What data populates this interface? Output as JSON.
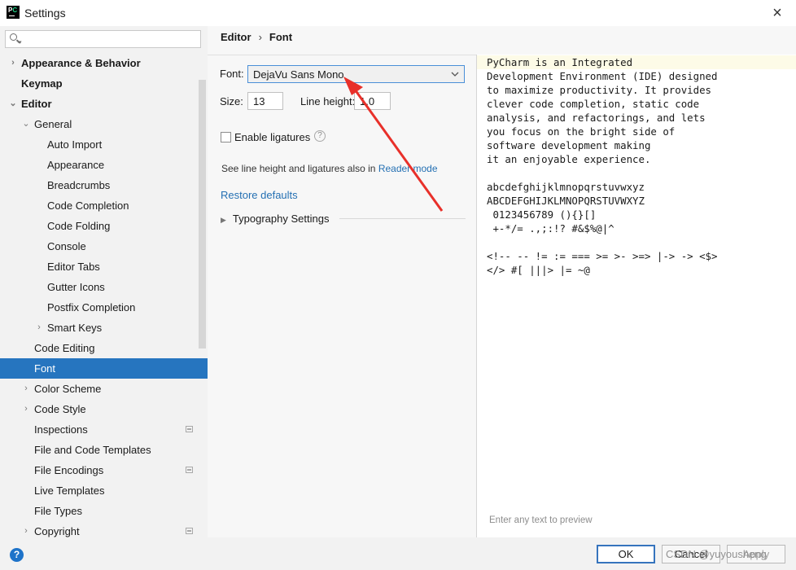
{
  "window": {
    "title": "Settings",
    "icon": "pycharm-icon",
    "close": "×"
  },
  "search": {
    "placeholder": ""
  },
  "sidebar": {
    "items": [
      {
        "label": "Appearance & Behavior",
        "bold": true,
        "chevron": "›"
      },
      {
        "label": "Keymap",
        "bold": true
      },
      {
        "label": "Editor",
        "bold": true,
        "chevron": "⌄"
      },
      {
        "label": "General",
        "chevron": "⌄"
      },
      {
        "label": "Auto Import"
      },
      {
        "label": "Appearance"
      },
      {
        "label": "Breadcrumbs"
      },
      {
        "label": "Code Completion"
      },
      {
        "label": "Code Folding"
      },
      {
        "label": "Console"
      },
      {
        "label": "Editor Tabs"
      },
      {
        "label": "Gutter Icons"
      },
      {
        "label": "Postfix Completion"
      },
      {
        "label": "Smart Keys",
        "chevron": "›"
      },
      {
        "label": "Code Editing"
      },
      {
        "label": "Font",
        "selected": true
      },
      {
        "label": "Color Scheme",
        "chevron": "›"
      },
      {
        "label": "Code Style",
        "chevron": "›"
      },
      {
        "label": "Inspections",
        "project_icon": true
      },
      {
        "label": "File and Code Templates"
      },
      {
        "label": "File Encodings",
        "project_icon": true
      },
      {
        "label": "Live Templates"
      },
      {
        "label": "File Types"
      },
      {
        "label": "Copyright",
        "chevron": "›",
        "project_icon": true
      }
    ]
  },
  "breadcrumb": {
    "parent": "Editor",
    "separator": "›",
    "current": "Font"
  },
  "font_settings": {
    "font_label": "Font:",
    "font_value": "DejaVu Sans Mono",
    "size_label": "Size:",
    "size_value": "13",
    "line_height_label": "Line height:",
    "line_height_value": "1.0",
    "ligatures_label": "Enable ligatures",
    "ligatures_checked": false,
    "help_glyph": "?",
    "see_text": "See line height and ligatures also in",
    "see_link": "Reader mode",
    "restore_defaults": "Restore defaults",
    "typography_toggle": "▶",
    "typography_label": "Typography Settings"
  },
  "preview": {
    "lines": [
      "PyCharm is an Integrated",
      "Development Environment (IDE) designed",
      "to maximize productivity. It provides",
      "clever code completion, static code",
      "analysis, and refactorings, and lets",
      "you focus on the bright side of",
      "software development making",
      "it an enjoyable experience.",
      "",
      "abcdefghijklmnopqrstuvwxyz",
      "ABCDEFGHIJKLMNOPQRSTUVWXYZ",
      " 0123456789 (){}[]",
      " +-*/= .,;:!? #&$%@|^",
      "",
      "<!-- -- != := === >= >- >=> |-> -> <$>",
      "</> #[ |||> |= ~@"
    ],
    "hint": "Enter any text to preview"
  },
  "footer": {
    "help": "?",
    "ok": "OK",
    "cancel": "Cancel",
    "apply": "Apply",
    "watermark": "CSDN @yuyousheng"
  },
  "colors": {
    "accent": "#2675bf",
    "annotation_arrow": "#e8302a",
    "preview_highlight": "#fdfbe7"
  }
}
